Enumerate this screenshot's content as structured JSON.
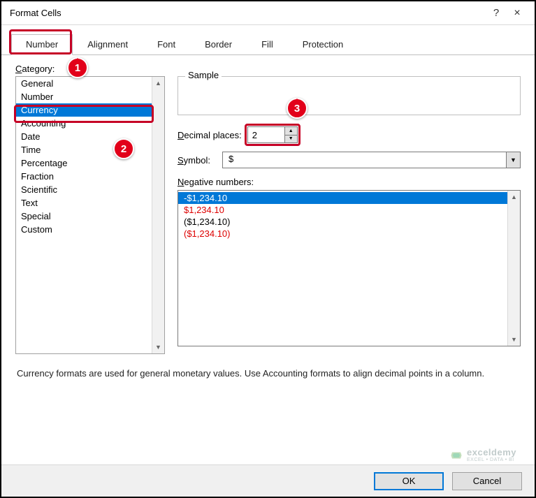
{
  "window": {
    "title": "Format Cells",
    "help_tooltip": "?",
    "close_tooltip": "×"
  },
  "tabs": [
    {
      "label": "Number",
      "active": true
    },
    {
      "label": "Alignment",
      "active": false
    },
    {
      "label": "Font",
      "active": false
    },
    {
      "label": "Border",
      "active": false
    },
    {
      "label": "Fill",
      "active": false
    },
    {
      "label": "Protection",
      "active": false
    }
  ],
  "category_label": "Category:",
  "categories": [
    "General",
    "Number",
    "Currency",
    "Accounting",
    "Date",
    "Time",
    "Percentage",
    "Fraction",
    "Scientific",
    "Text",
    "Special",
    "Custom"
  ],
  "selected_category": "Currency",
  "sample_label": "Sample",
  "decimal_label": "Decimal places:",
  "decimal_value": "2",
  "symbol_label": "Symbol:",
  "symbol_value": "$",
  "negative_label": "Negative numbers:",
  "negative_items": [
    {
      "text": "-$1,234.10",
      "selected": true,
      "red": false
    },
    {
      "text": "$1,234.10",
      "selected": false,
      "red": true
    },
    {
      "text": "($1,234.10)",
      "selected": false,
      "red": false
    },
    {
      "text": "($1,234.10)",
      "selected": false,
      "red": true
    }
  ],
  "description": "Currency formats are used for general monetary values.  Use Accounting formats to align decimal points in a column.",
  "buttons": {
    "ok": "OK",
    "cancel": "Cancel"
  },
  "callouts": {
    "c1": "1",
    "c2": "2",
    "c3": "3"
  },
  "watermark": {
    "brand": "exceldemy",
    "tagline": "EXCEL • DATA • BI"
  }
}
